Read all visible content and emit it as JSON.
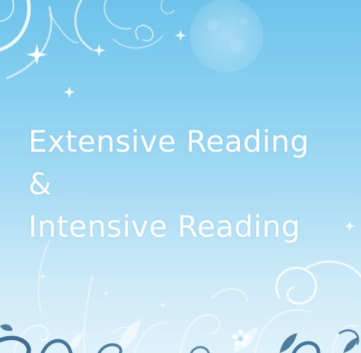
{
  "slide": {
    "title_line_1": "Extensive Reading",
    "title_line_2": "&",
    "title_line_3": "Intensive Reading"
  },
  "colors": {
    "background_top": "#6ec3ea",
    "background_bottom": "#dff2fb",
    "text": "#ffffff",
    "ornament": "#ffffff",
    "ornament_dark": "#2b5f88"
  },
  "icons": [
    "moon-icon",
    "sparkle-star-icon",
    "swirl-vine-ornament",
    "flower-ornament"
  ]
}
